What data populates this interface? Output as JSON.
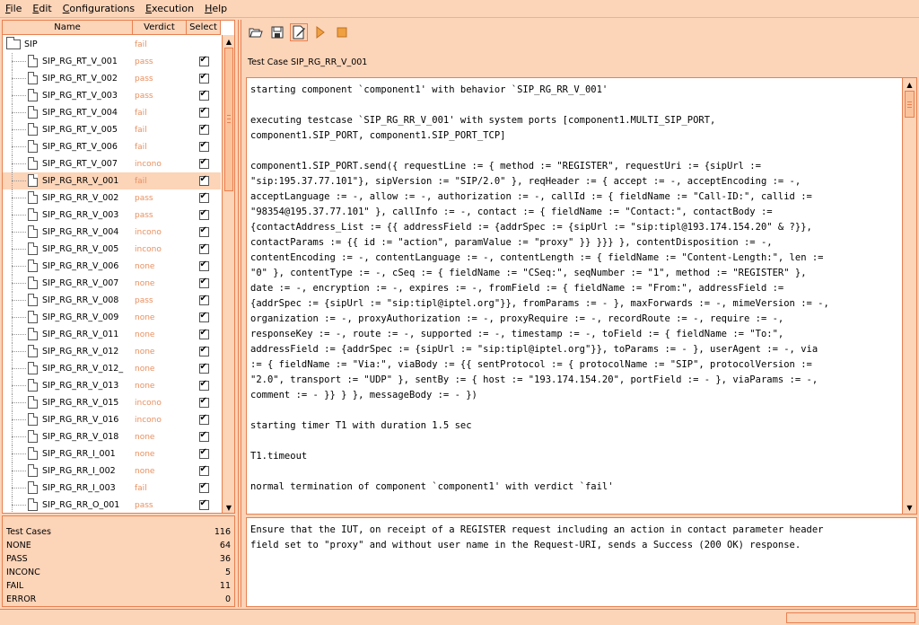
{
  "menubar": {
    "items": [
      {
        "mnemonic": "F",
        "rest": "ile"
      },
      {
        "mnemonic": "E",
        "rest": "dit"
      },
      {
        "mnemonic": "C",
        "rest": "onfigurations"
      },
      {
        "mnemonic": "E",
        "rest": "xecution"
      },
      {
        "mnemonic": "H",
        "rest": "elp"
      }
    ]
  },
  "tree": {
    "headers": {
      "name": "Name",
      "verdict": "Verdict",
      "select": "Select"
    },
    "root": {
      "name": "SIP",
      "verdict": "fail"
    },
    "rows": [
      {
        "name": "SIP_RG_RT_V_001",
        "verdict": "pass"
      },
      {
        "name": "SIP_RG_RT_V_002",
        "verdict": "pass"
      },
      {
        "name": "SIP_RG_RT_V_003",
        "verdict": "pass"
      },
      {
        "name": "SIP_RG_RT_V_004",
        "verdict": "fail"
      },
      {
        "name": "SIP_RG_RT_V_005",
        "verdict": "fail"
      },
      {
        "name": "SIP_RG_RT_V_006",
        "verdict": "fail"
      },
      {
        "name": "SIP_RG_RT_V_007",
        "verdict": "incono"
      },
      {
        "name": "SIP_RG_RR_V_001",
        "verdict": "fail"
      },
      {
        "name": "SIP_RG_RR_V_002",
        "verdict": "pass"
      },
      {
        "name": "SIP_RG_RR_V_003",
        "verdict": "pass"
      },
      {
        "name": "SIP_RG_RR_V_004",
        "verdict": "incono"
      },
      {
        "name": "SIP_RG_RR_V_005",
        "verdict": "incono"
      },
      {
        "name": "SIP_RG_RR_V_006",
        "verdict": "none"
      },
      {
        "name": "SIP_RG_RR_V_007",
        "verdict": "none"
      },
      {
        "name": "SIP_RG_RR_V_008",
        "verdict": "pass"
      },
      {
        "name": "SIP_RG_RR_V_009",
        "verdict": "none"
      },
      {
        "name": "SIP_RG_RR_V_011",
        "verdict": "none"
      },
      {
        "name": "SIP_RG_RR_V_012",
        "verdict": "none"
      },
      {
        "name": "SIP_RG_RR_V_012_",
        "verdict": "none"
      },
      {
        "name": "SIP_RG_RR_V_013",
        "verdict": "none"
      },
      {
        "name": "SIP_RG_RR_V_015",
        "verdict": "incono"
      },
      {
        "name": "SIP_RG_RR_V_016",
        "verdict": "incono"
      },
      {
        "name": "SIP_RG_RR_V_018",
        "verdict": "none"
      },
      {
        "name": "SIP_RG_RR_I_001",
        "verdict": "none"
      },
      {
        "name": "SIP_RG_RR_I_002",
        "verdict": "none"
      },
      {
        "name": "SIP_RG_RR_I_003",
        "verdict": "fail"
      },
      {
        "name": "SIP_RG_RR_O_001",
        "verdict": "pass"
      }
    ]
  },
  "stats": [
    {
      "label": "Test Cases",
      "value": "116"
    },
    {
      "label": "NONE",
      "value": "64"
    },
    {
      "label": "PASS",
      "value": "36"
    },
    {
      "label": "INCONC",
      "value": "5"
    },
    {
      "label": "FAIL",
      "value": "11"
    },
    {
      "label": "ERROR",
      "value": "0"
    }
  ],
  "testcase_label": "Test Case SIP_RG_RR_V_001",
  "log": [
    "starting component `component1' with behavior `SIP_RG_RR_V_001'",
    "executing testcase `SIP_RG_RR_V_001' with system ports [component1.MULTI_SIP_PORT,\ncomponent1.SIP_PORT, component1.SIP_PORT_TCP]",
    "component1.SIP_PORT.send({ requestLine := { method := \"REGISTER\", requestUri := {sipUrl :=\n\"sip:195.37.77.101\"}, sipVersion := \"SIP/2.0\" }, reqHeader := { accept := -, acceptEncoding := -,\nacceptLanguage := -, allow := -, authorization := -, callId := { fieldName := \"Call-ID:\", callid :=\n\"98354@195.37.77.101\" }, callInfo := -, contact := { fieldName := \"Contact:\", contactBody :=\n{contactAddress_List := {{ addressField := {addrSpec := {sipUrl := \"sip:tipl@193.174.154.20\" & ?}},\ncontactParams := {{ id := \"action\", paramValue := \"proxy\" }} }}} }, contentDisposition := -,\ncontentEncoding := -, contentLanguage := -, contentLength := { fieldName := \"Content-Length:\", len :=\n\"0\" }, contentType := -, cSeq := { fieldName := \"CSeq:\", seqNumber := \"1\", method := \"REGISTER\" },\ndate := -, encryption := -, expires := -, fromField := { fieldName := \"From:\", addressField :=\n{addrSpec := {sipUrl := \"sip:tipl@iptel.org\"}}, fromParams := - }, maxForwards := -, mimeVersion := -,\norganization := -, proxyAuthorization := -, proxyRequire := -, recordRoute := -, require := -,\nresponseKey := -, route := -, supported := -, timestamp := -, toField := { fieldName := \"To:\",\naddressField := {addrSpec := {sipUrl := \"sip:tipl@iptel.org\"}}, toParams := - }, userAgent := -, via\n:= { fieldName := \"Via:\", viaBody := {{ sentProtocol := { protocolName := \"SIP\", protocolVersion :=\n\"2.0\", transport := \"UDP\" }, sentBy := { host := \"193.174.154.20\", portField := - }, viaParams := -,\ncomment := - }} } }, messageBody := - })",
    "starting timer T1 with duration 1.5 sec",
    "T1.timeout",
    "normal termination of component `component1' with verdict `fail'"
  ],
  "description": "Ensure that the IUT, on receipt of a REGISTER request including an action in contact parameter header\nfield set to \"proxy\" and without user name in the Request-URI, sends a Success (200 OK) response.",
  "colors": {
    "accent": "#fcd4b8",
    "border": "#e88050",
    "verdict": "#e89060"
  }
}
